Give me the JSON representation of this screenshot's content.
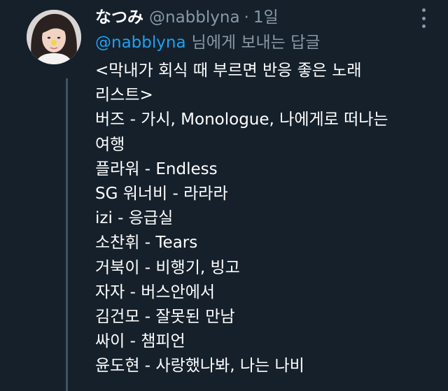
{
  "tweet": {
    "display_name": "なつみ",
    "handle": "@nabblyna",
    "separator": "·",
    "time": "1일",
    "reply": {
      "mention": "@nabblyna",
      "rest": "님에게 보내는 답글"
    },
    "lines": [
      "<막내가 회식 때 부르면 반응 좋은 노래",
      "리스트>",
      "버즈 - 가시, Monologue, 나에게로 떠나는",
      "여행",
      "플라워 - Endless",
      "SG 워너비 - 라라라",
      "izi - 응급실",
      "소찬휘 - Tears",
      "거북이 - 비행기, 빙고",
      "자자 - 버스안에서",
      "김건모 - 잘못된 만남",
      "싸이 - 챔피언",
      "윤도현 - 사랑했나봐, 나는 나비"
    ]
  },
  "icons": {
    "more": "more-vertical-icon",
    "avatar": "avatar"
  },
  "colors": {
    "background": "#15202b",
    "text_primary": "#ffffff",
    "text_secondary": "#8899a6",
    "accent": "#1da1f2",
    "thread_line": "#3d5466"
  }
}
